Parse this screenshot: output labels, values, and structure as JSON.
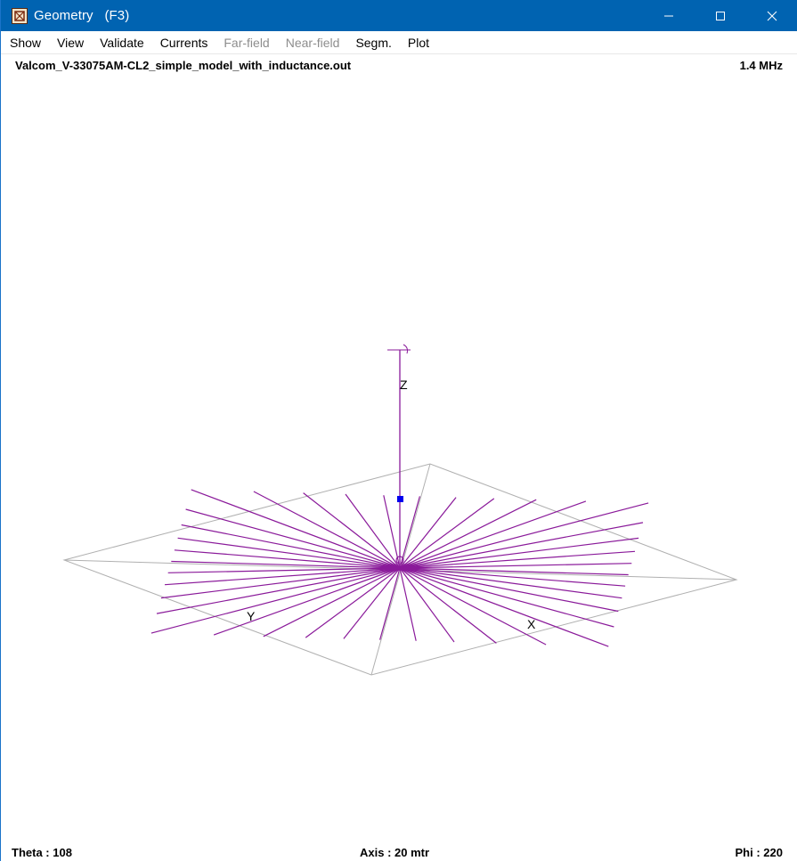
{
  "window": {
    "title": "Geometry   (F3)",
    "icon": "geometry-app-icon"
  },
  "menu": [
    {
      "label": "Show",
      "enabled": true
    },
    {
      "label": "View",
      "enabled": true
    },
    {
      "label": "Validate",
      "enabled": true
    },
    {
      "label": "Currents",
      "enabled": true
    },
    {
      "label": "Far-field",
      "enabled": false
    },
    {
      "label": "Near-field",
      "enabled": false
    },
    {
      "label": "Segm.",
      "enabled": true
    },
    {
      "label": "Plot",
      "enabled": true
    }
  ],
  "header": {
    "filename": "Valcom_V-33075AM-CL2_simple_model_with_inductance.out",
    "frequency": "1.4 MHz"
  },
  "view": {
    "axes": {
      "z": "Z",
      "y": "Y",
      "x": "X"
    },
    "radial_count": 40,
    "colors": {
      "wires": "#8a1a9a",
      "ground_plane": "#b0b0b0",
      "source": "#0000ee",
      "axis": "#8a1a9a"
    }
  },
  "status": {
    "theta_label": "Theta : ",
    "theta_value": "108",
    "axis_label": "Axis : ",
    "axis_value": "20 mtr",
    "phi_label": "Phi : ",
    "phi_value": "220"
  }
}
